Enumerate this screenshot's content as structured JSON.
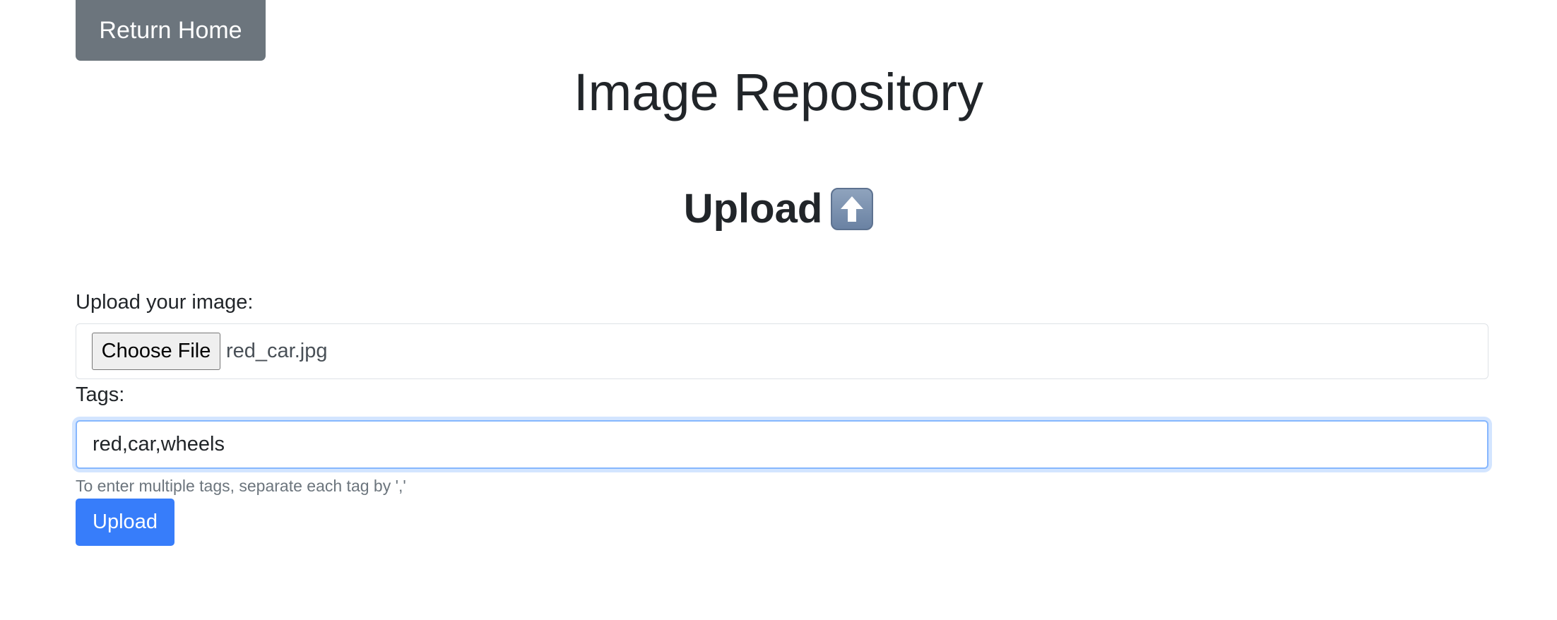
{
  "nav": {
    "return_home_label": "Return Home"
  },
  "header": {
    "title": "Image Repository",
    "subtitle": "Upload",
    "subtitle_icon": "up-arrow-emoji-icon"
  },
  "form": {
    "image_label": "Upload your image:",
    "choose_file_label": "Choose File",
    "file_name": "red_car.jpg",
    "tags_label": "Tags:",
    "tags_value": "red,car,wheels",
    "tags_hint": "To enter multiple tags, separate each tag by ','",
    "submit_label": "Upload"
  },
  "colors": {
    "return_home_bg": "#6c757d",
    "upload_bg": "#377dfa",
    "focus_border": "#86b7fe"
  }
}
